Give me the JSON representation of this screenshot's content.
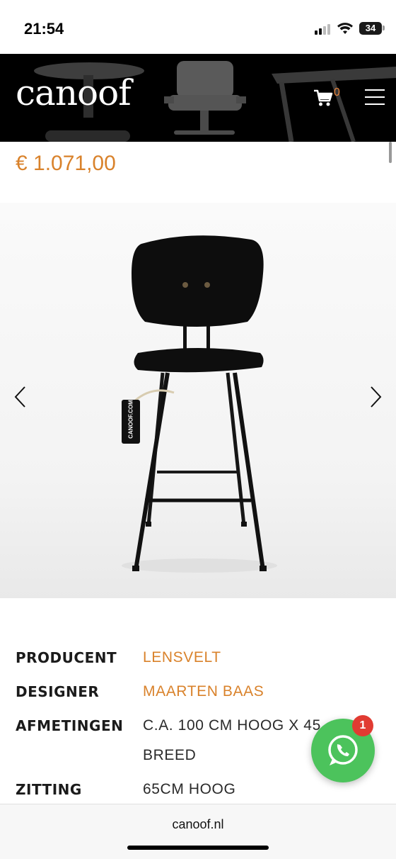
{
  "status_bar": {
    "time": "21:54",
    "battery_level": "34"
  },
  "header": {
    "logo": "canoof",
    "cart_count": "0"
  },
  "product": {
    "price": "€ 1.071,00",
    "tag_text": "CANOOF.COM"
  },
  "specs": [
    {
      "label": "PRODUCENT",
      "value": "LENSVELT"
    },
    {
      "label": "DESIGNER",
      "value": "MAARTEN BAAS"
    },
    {
      "label": "AFMETINGEN",
      "value_line1": "C.A. 100 CM HOOG X 45",
      "value_line2": "BREED"
    },
    {
      "label": "ZITTING",
      "value": "65CM HOOG"
    }
  ],
  "whatsapp": {
    "badge_count": "1"
  },
  "browser": {
    "url": "canoof.nl"
  },
  "colors": {
    "accent": "#d9822b",
    "whatsapp": "#4cc35c",
    "badge": "#e13b32",
    "header_bg": "#000000"
  }
}
